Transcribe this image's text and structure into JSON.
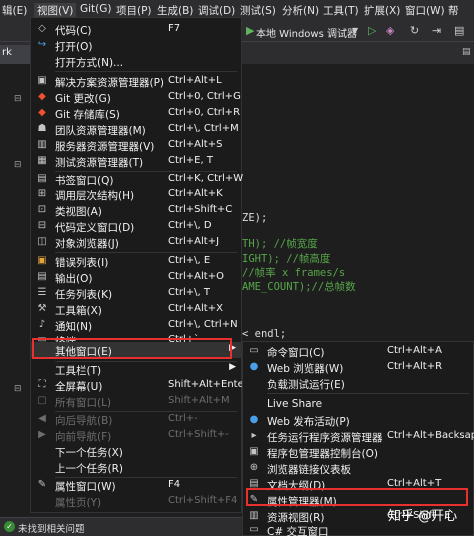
{
  "menubar": {
    "items": [
      "辑(E)",
      "视图(V)",
      "Git(G)",
      "项目(P)",
      "生成(B)",
      "调试(D)",
      "测试(S)",
      "分析(N)",
      "工具(T)",
      "扩展(X)",
      "窗口(W)",
      "帮"
    ]
  },
  "toolbar": {
    "run_label": "本地 Windows 调试器"
  },
  "tabs": {
    "active": "rk"
  },
  "editor": {
    "code_lines": [
      "ZE);",
      "TH);  //帧宽度",
      "IGHT); //帧高度",
      "  //帧率 x frames/s",
      "AME_COUNT);//总帧数",
      "< endl;"
    ]
  },
  "view_menu": {
    "items": [
      {
        "icon": "code-icon",
        "label": "代码(C)",
        "shortcut": "F7"
      },
      {
        "icon": "open-icon",
        "label": "打开(O)",
        "shortcut": ""
      },
      {
        "icon": "",
        "label": "打开方式(N)...",
        "shortcut": ""
      },
      {
        "icon": "solution-explorer-icon",
        "label": "解决方案资源管理器(P)",
        "shortcut": "Ctrl+Alt+L"
      },
      {
        "icon": "git-changes-icon",
        "label": "Git 更改(G)",
        "shortcut": "Ctrl+0, Ctrl+G"
      },
      {
        "icon": "git-repo-icon",
        "label": "Git 存储库(S)",
        "shortcut": "Ctrl+0, Ctrl+R"
      },
      {
        "icon": "team-explorer-icon",
        "label": "团队资源管理器(M)",
        "shortcut": "Ctrl+\\, Ctrl+M"
      },
      {
        "icon": "server-explorer-icon",
        "label": "服务器资源管理器(V)",
        "shortcut": "Ctrl+Alt+S"
      },
      {
        "icon": "test-explorer-icon",
        "label": "测试资源管理器(T)",
        "shortcut": "Ctrl+E, T"
      },
      {
        "icon": "bookmark-icon",
        "label": "书签窗口(Q)",
        "shortcut": "Ctrl+K, Ctrl+W"
      },
      {
        "icon": "call-hierarchy-icon",
        "label": "调用层次结构(H)",
        "shortcut": "Ctrl+Alt+K"
      },
      {
        "icon": "class-view-icon",
        "label": "类视图(A)",
        "shortcut": "Ctrl+Shift+C"
      },
      {
        "icon": "code-definition-icon",
        "label": "代码定义窗口(D)",
        "shortcut": "Ctrl+\\, D"
      },
      {
        "icon": "object-browser-icon",
        "label": "对象浏览器(J)",
        "shortcut": "Ctrl+Alt+J"
      },
      {
        "icon": "error-list-icon",
        "label": "错误列表(I)",
        "shortcut": "Ctrl+\\, E"
      },
      {
        "icon": "output-icon",
        "label": "输出(O)",
        "shortcut": "Ctrl+Alt+O"
      },
      {
        "icon": "task-list-icon",
        "label": "任务列表(K)",
        "shortcut": "Ctrl+\\, T"
      },
      {
        "icon": "toolbox-icon",
        "label": "工具箱(X)",
        "shortcut": "Ctrl+Alt+X"
      },
      {
        "icon": "notification-icon",
        "label": "通知(N)",
        "shortcut": "Ctrl+\\, Ctrl+N"
      },
      {
        "icon": "terminal-icon",
        "label": "终端",
        "shortcut": "Ctrl+`"
      },
      {
        "icon": "",
        "label": "其他窗口(E)",
        "shortcut": ""
      },
      {
        "icon": "",
        "label": "工具栏(T)",
        "shortcut": ""
      },
      {
        "icon": "fullscreen-icon",
        "label": "全屏幕(U)",
        "shortcut": "Shift+Alt+Enter"
      },
      {
        "icon": "all-windows-icon",
        "label": "所有窗口(L)",
        "shortcut": "Shift+Alt+M"
      },
      {
        "icon": "navigate-back-icon",
        "label": "向后导航(B)",
        "shortcut": "Ctrl+-"
      },
      {
        "icon": "navigate-forward-icon",
        "label": "向前导航(F)",
        "shortcut": "Ctrl+Shift+-"
      },
      {
        "icon": "",
        "label": "下一个任务(X)",
        "shortcut": ""
      },
      {
        "icon": "",
        "label": "上一个任务(R)",
        "shortcut": ""
      },
      {
        "icon": "properties-window-icon",
        "label": "属性窗口(W)",
        "shortcut": "F4"
      },
      {
        "icon": "property-pages-icon",
        "label": "属性页(Y)",
        "shortcut": "Ctrl+Shift+F4"
      }
    ]
  },
  "other_windows_submenu": {
    "items": [
      {
        "icon": "command-window-icon",
        "label": "命令窗口(C)",
        "shortcut": "Ctrl+Alt+A"
      },
      {
        "icon": "web-browser-icon",
        "label": "Web 浏览器(W)",
        "shortcut": "Ctrl+Alt+R"
      },
      {
        "icon": "",
        "label": "负载测试运行(E)",
        "shortcut": ""
      },
      {
        "icon": "",
        "label": "Live Share",
        "shortcut": ""
      },
      {
        "icon": "web-publish-icon",
        "label": "Web 发布活动(P)",
        "shortcut": ""
      },
      {
        "icon": "task-runner-icon",
        "label": "任务运行程序资源管理器",
        "shortcut": "Ctrl+Alt+Backsapce"
      },
      {
        "icon": "package-manager-icon",
        "label": "程序包管理器控制台(O)",
        "shortcut": ""
      },
      {
        "icon": "browser-link-icon",
        "label": "浏览器链接仪表板",
        "shortcut": ""
      },
      {
        "icon": "document-outline-icon",
        "label": "文档大纲(D)",
        "shortcut": "Ctrl+Alt+T"
      },
      {
        "icon": "property-manager-icon",
        "label": "属性管理器(M)",
        "shortcut": ""
      },
      {
        "icon": "resource-view-icon",
        "label": "资源视图(R)",
        "shortcut": "Ctrl+Shift+E"
      },
      {
        "icon": "csharp-interactive-icon",
        "label": "C# 交互窗口",
        "shortcut": ""
      }
    ]
  },
  "statusbar": {
    "text": "未找到相关问题"
  },
  "watermark": "知乎 @开心",
  "colors": {
    "highlight_box": "#e8312e",
    "menu_bg": "#1b1b1c",
    "ide_bg": "#2d2d30",
    "editor_bg": "#1e1e1e",
    "comment": "#57a64a"
  }
}
